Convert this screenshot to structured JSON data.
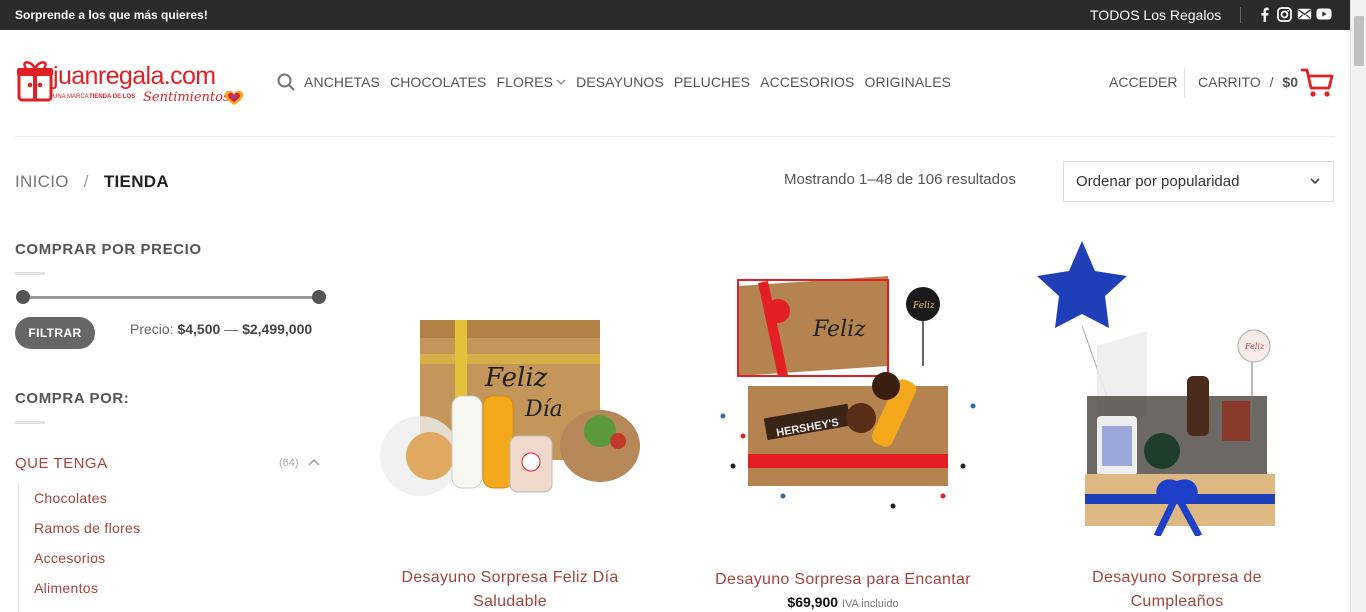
{
  "topbar": {
    "promo": "Sorprende a los que más quieres!",
    "all_gifts": "TODOS Los Regalos",
    "social": [
      "facebook-icon",
      "instagram-icon",
      "email-icon",
      "youtube-icon"
    ]
  },
  "brand": {
    "name": "juanregala.com",
    "tagline_prefix": "UNA MARCA",
    "tagline_mid": "TIENDA DE LOS",
    "tagline_script": "Sentimientos",
    "color": "#e31e24"
  },
  "nav": {
    "items": [
      "ANCHETAS",
      "CHOCOLATES",
      "FLORES",
      "DESAYUNOS",
      "PELUCHES",
      "ACCESORIOS",
      "ORIGINALES"
    ],
    "login": "ACCEDER",
    "cart_label": "CARRITO",
    "cart_sep": "/",
    "cart_total": "$0"
  },
  "breadcrumb": {
    "home": "INICIO",
    "divider": "/",
    "current": "TIENDA"
  },
  "results": {
    "text": "Mostrando 1–48 de 106 resultados",
    "sort_selected": "Ordenar por popularidad"
  },
  "sidebar": {
    "price_heading": "COMPRAR POR PRECIO",
    "filter_button": "FILTRAR",
    "price_label": "Precio:",
    "price_min": "$4,500",
    "price_dash": "—",
    "price_max": "$2,499,000",
    "buy_by_heading": "COMPRA POR:",
    "category": {
      "name": "QUE TENGA",
      "count": "(64)",
      "children": [
        "Chocolates",
        "Ramos de flores",
        "Accesorios",
        "Alimentos"
      ]
    }
  },
  "products": [
    {
      "name_line1": "Desayuno Sorpresa Feliz Día",
      "name_line2": "Saludable",
      "price": "",
      "tax": ""
    },
    {
      "name_line1": "Desayuno Sorpresa para Encantar",
      "name_line2": "",
      "price": "$69,900",
      "tax": "IVA incluido"
    },
    {
      "name_line1": "Desayuno Sorpresa de",
      "name_line2": "Cumpleaños",
      "price": "",
      "tax": ""
    }
  ],
  "colors": {
    "accent": "#a2443f",
    "brand_red": "#e31e24",
    "topbar": "#2b2b2b"
  }
}
